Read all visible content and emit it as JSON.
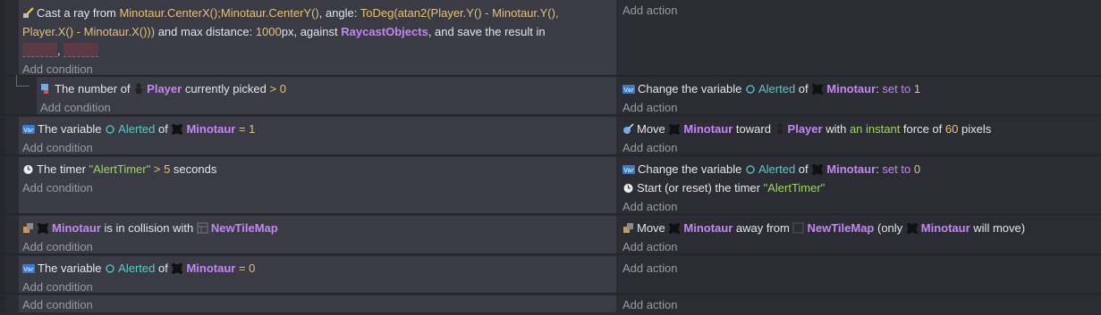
{
  "add_condition": "Add condition",
  "add_action": "Add action",
  "events": {
    "raycast": {
      "prefix": "Cast a ray from ",
      "origin": "Minotaur.CenterX();Minotaur.CenterY()",
      "angle_label": ", angle: ",
      "angle_expr": "ToDeg(atan2(Player.Y() - Minotaur.Y(), Player.X() - Minotaur.X()))",
      "dist_label": " and max distance: ",
      "dist_value": "1000",
      "dist_unit": "px, against ",
      "against": "RaycastObjects",
      "save_label": ", and save the result in",
      "comma": ","
    },
    "picked": {
      "text1": "The number of ",
      "object": "Player",
      "text2": " currently picked ",
      "op": ">",
      "value": "0",
      "action": {
        "text1": "Change the variable ",
        "variable": "Alerted",
        "text2": " of ",
        "object": "Minotaur",
        "colon": ":",
        "op": " set to ",
        "value": "1"
      }
    },
    "alerted1": {
      "text1": "The variable ",
      "variable": "Alerted",
      "text2": " of ",
      "object": "Minotaur",
      "op": "=",
      "value": "1",
      "action": {
        "text1": "Move ",
        "object": "Minotaur",
        "text2": " toward ",
        "target": "Player",
        "text3": " with ",
        "force_type": "an instant",
        "text4": " force of ",
        "value": "60",
        "text5": " pixels"
      }
    },
    "timer": {
      "text1": "The timer ",
      "name": "\"AlertTimer\"",
      "op": ">",
      "value": "5",
      "unit": " seconds",
      "action1": {
        "text1": "Change the variable ",
        "variable": "Alerted",
        "text2": " of ",
        "object": "Minotaur",
        "colon": ":",
        "op": " set to ",
        "value": "0"
      },
      "action2": {
        "text1": "Start (or reset) the timer ",
        "name": "\"AlertTimer\""
      }
    },
    "collision": {
      "object": "Minotaur",
      "text1": " is in collision with ",
      "target": "NewTileMap",
      "action": {
        "text1": "Move ",
        "object": "Minotaur",
        "text2": " away from ",
        "target": "NewTileMap",
        "text3": " (only ",
        "object2": "Minotaur",
        "text4": " will move)"
      }
    },
    "alerted0": {
      "text1": "The variable ",
      "variable": "Alerted",
      "text2": " of ",
      "object": "Minotaur",
      "op": "=",
      "value": "0"
    }
  },
  "icons": {
    "raycast": "raycast-icon",
    "count": "object-count-icon",
    "variable": "variable-icon",
    "minotaur": "minotaur-sprite-icon",
    "player": "player-sprite-icon",
    "timer": "timer-icon",
    "collision": "collision-icon",
    "tilemap": "tilemap-icon",
    "force": "force-icon"
  }
}
